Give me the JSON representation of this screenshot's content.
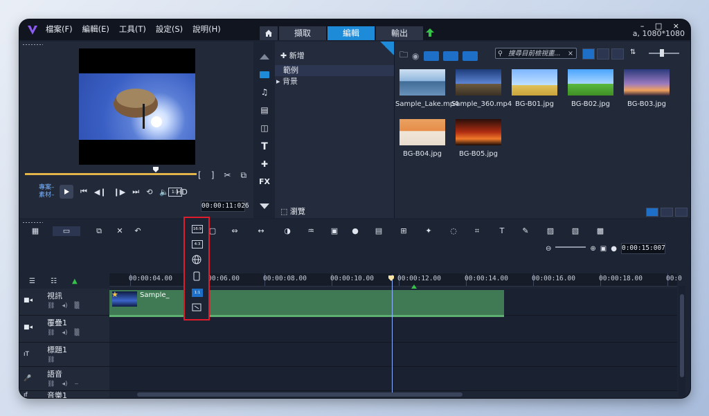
{
  "titlebar": {
    "menu": [
      "檔案(F)",
      "編輯(E)",
      "工具(T)",
      "設定(S)",
      "說明(H)"
    ],
    "tabs": [
      "擷取",
      "編輯",
      "輸出"
    ],
    "active_tab": "編輯",
    "window_controls": "– □ ×",
    "resolution_info": "a, 1080*1080"
  },
  "preview": {
    "mode_project": "專案–",
    "mode_clip": "素材–",
    "hd_label": "HD",
    "ratio_label": "1:1",
    "timecode": "00:00:11:026"
  },
  "library": {
    "add_new": "新增",
    "tree": [
      "範例",
      "背景"
    ],
    "browse": "瀏覽",
    "search_placeholder": "搜尋目前檢視畫...",
    "thumbnails": [
      {
        "name": "Sample_Lake.mp4"
      },
      {
        "name": "Sample_360.mp4"
      },
      {
        "name": "BG-B01.jpg"
      },
      {
        "name": "BG-B02.jpg"
      },
      {
        "name": "BG-B03.jpg"
      },
      {
        "name": "BG-B04.jpg"
      },
      {
        "name": "BG-B05.jpg"
      }
    ]
  },
  "timeline": {
    "timecode": "0:00:15:007",
    "ruler": [
      "00:00:04.00",
      "00:00:06.00",
      "00:00:08.00",
      "00:00:10.00",
      "00:00:12.00",
      "00:00:14.00",
      "00:00:16.00",
      "00:00:18.00",
      "00:0"
    ],
    "tracks": [
      {
        "name": "視訊"
      },
      {
        "name": "覆疊1"
      },
      {
        "name": "標題1"
      },
      {
        "name": "語音"
      },
      {
        "name": "音樂1"
      }
    ],
    "clip_label": "Sample_"
  },
  "ratio_dropdown": {
    "options": [
      "16:9",
      "4:3",
      "360",
      "9:16",
      "1:1",
      "custom"
    ],
    "selected": "1:1"
  },
  "colors": {
    "accent": "#1e8bd8",
    "highlight_border": "#e01c2c",
    "clip_green": "#3f7a55",
    "app_bg": "#1b2232"
  }
}
